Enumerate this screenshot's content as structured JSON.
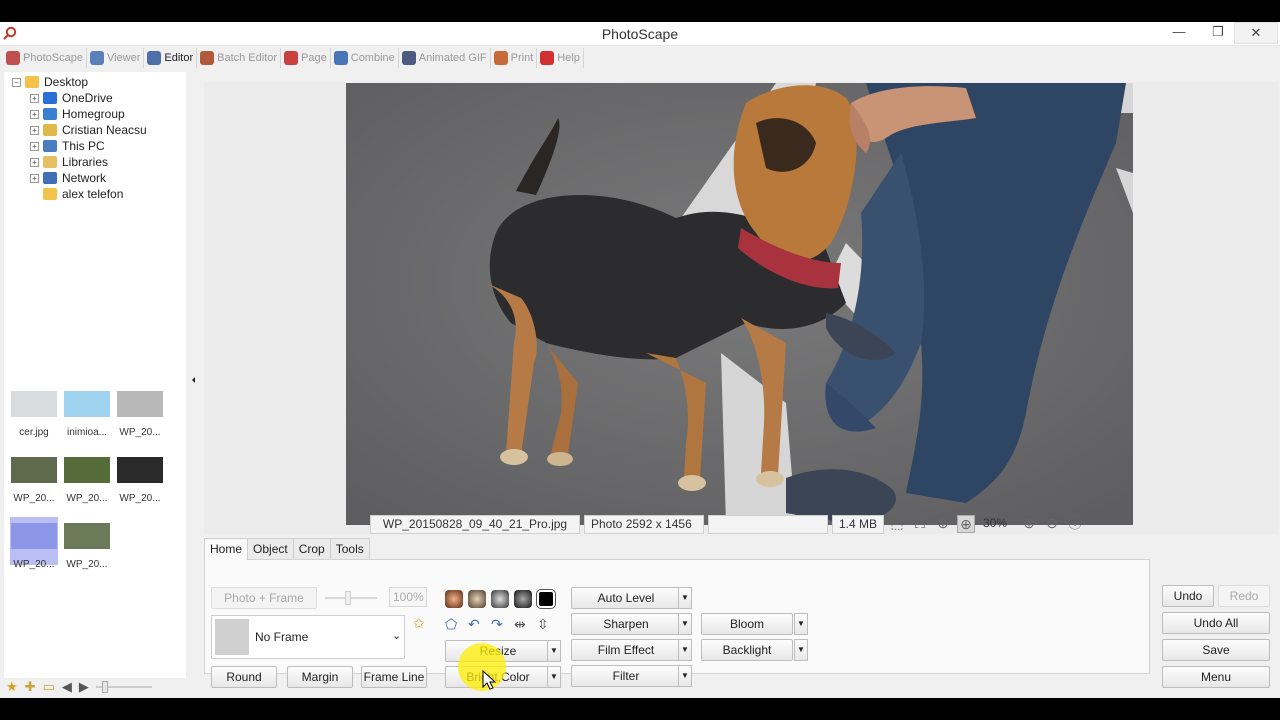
{
  "window": {
    "title": "PhotoScape",
    "controls": [
      "—",
      "❐",
      "✕"
    ]
  },
  "menu": [
    {
      "label": "PhotoScape",
      "icon": "photoscape-icon",
      "color": "#c0504d",
      "active": false
    },
    {
      "label": "Viewer",
      "icon": "viewer-icon",
      "color": "#5b7fb8",
      "active": false
    },
    {
      "label": "Editor",
      "icon": "editor-icon",
      "color": "#4f6fa8",
      "active": true
    },
    {
      "label": "Batch Editor",
      "icon": "batch-editor-icon",
      "color": "#b05a3a",
      "active": false
    },
    {
      "label": "Page",
      "icon": "page-icon",
      "color": "#c84040",
      "active": false
    },
    {
      "label": "Combine",
      "icon": "combine-icon",
      "color": "#4a74b8",
      "active": false
    },
    {
      "label": "Animated GIF",
      "icon": "animated-gif-icon",
      "color": "#4a5a80",
      "active": false
    },
    {
      "label": "Print",
      "icon": "print-icon",
      "color": "#c8693a",
      "active": false
    },
    {
      "label": "Help",
      "icon": "help-icon",
      "color": "#d03030",
      "active": false
    }
  ],
  "tree": [
    {
      "label": "Desktop",
      "level": 0,
      "icon": "folder-icon",
      "color": "#f2c24b",
      "expander": "−"
    },
    {
      "label": "OneDrive",
      "level": 1,
      "icon": "onedrive-icon",
      "color": "#2a6ed8",
      "expander": "+"
    },
    {
      "label": "Homegroup",
      "level": 1,
      "icon": "homegroup-icon",
      "color": "#3a80d0",
      "expander": "+"
    },
    {
      "label": "Cristian Neacsu",
      "level": 1,
      "icon": "user-folder-icon",
      "color": "#e0b84a",
      "expander": "+"
    },
    {
      "label": "This PC",
      "level": 1,
      "icon": "computer-icon",
      "color": "#4a7cc0",
      "expander": "+"
    },
    {
      "label": "Libraries",
      "level": 1,
      "icon": "libraries-icon",
      "color": "#e6c060",
      "expander": "+"
    },
    {
      "label": "Network",
      "level": 1,
      "icon": "network-icon",
      "color": "#3f6fb5",
      "expander": "+"
    },
    {
      "label": "alex telefon",
      "level": 1,
      "icon": "folder-icon",
      "color": "#f2c24b",
      "expander": ""
    }
  ],
  "thumbnails": [
    {
      "label": "cer.jpg",
      "color": "#d9dcdf"
    },
    {
      "label": "inimioa...",
      "color": "#9fd3ef"
    },
    {
      "label": "WP_20...",
      "color": "#b8b8b8"
    },
    {
      "label": "WP_20...",
      "color": "#5d6a4c"
    },
    {
      "label": "WP_20...",
      "color": "#556b3a"
    },
    {
      "label": "WP_20...",
      "color": "#2a2a2a"
    },
    {
      "label": "WP_20...",
      "color": "#8c96e8"
    },
    {
      "label": "WP_20...",
      "color": "#6b7b5a"
    }
  ],
  "status": {
    "filename": "WP_20150828_09_40_21_Pro.jpg",
    "dimensions": "Photo 2592 x 1456",
    "empty": "",
    "size": "1.4 MB",
    "zoom": "30%"
  },
  "tabs": [
    {
      "label": "Home",
      "active": true
    },
    {
      "label": "Object",
      "active": false
    },
    {
      "label": "Crop",
      "active": false
    },
    {
      "label": "Tools",
      "active": false
    }
  ],
  "editor": {
    "photo_frame_label": "Photo + Frame",
    "percent_value": "100%",
    "frame_select_value": "No Frame",
    "round_label": "Round",
    "margin_label": "Margin",
    "frame_line_label": "Frame Line",
    "resize_label": "Resize",
    "bright_color_label": "Bright,Color",
    "auto_level_label": "Auto Level",
    "sharpen_label": "Sharpen",
    "film_effect_label": "Film Effect",
    "filter_label": "Filter",
    "bloom_label": "Bloom",
    "backlight_label": "Backlight"
  },
  "history": {
    "undo_label": "Undo",
    "redo_label": "Redo",
    "undo_all_label": "Undo All",
    "save_label": "Save",
    "menu_label": "Menu"
  }
}
